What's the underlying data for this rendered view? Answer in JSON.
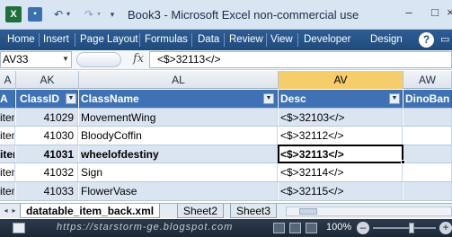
{
  "window": {
    "title": "Book3 - Microsoft Excel non-commercial use",
    "app_icon": "excel-icon",
    "qat_icons": [
      "save-icon",
      "undo-icon",
      "redo-icon",
      "customize-qat-icon"
    ],
    "controls": {
      "minimize": "–",
      "maximize": "□",
      "close": "×"
    }
  },
  "ribbon": {
    "tabs": [
      "Home",
      "Insert",
      "Page Layout",
      "Formulas",
      "Data",
      "Review",
      "View",
      "Developer",
      "Design"
    ],
    "help": "?",
    "more": "▭"
  },
  "formula_bar": {
    "name_box": "AV33",
    "fx": "fx",
    "content": "<$>32113</>"
  },
  "columns": [
    {
      "id": "A",
      "label": "A"
    },
    {
      "id": "AK",
      "label": "AK"
    },
    {
      "id": "AL",
      "label": "AL"
    },
    {
      "id": "AV",
      "label": "AV",
      "active": true
    },
    {
      "id": "AW",
      "label": "AW"
    }
  ],
  "table": {
    "headers": [
      "A",
      "ClassID",
      "ClassName",
      "Desc",
      "DinoBan"
    ],
    "rows": [
      {
        "a": "item",
        "id": "41029",
        "name": "MovementWing",
        "desc": "<$>32103</>"
      },
      {
        "a": "item",
        "id": "41030",
        "name": "BloodyCoffin",
        "desc": "<$>32112</>"
      },
      {
        "a": "item",
        "id": "41031",
        "name": "wheelofdestiny",
        "desc": "<$>32113</>",
        "selected": true
      },
      {
        "a": "item",
        "id": "41032",
        "name": "Sign",
        "desc": "<$>32114</>"
      },
      {
        "a": "item",
        "id": "41033",
        "name": "FlowerVase",
        "desc": "<$>32115</>"
      }
    ]
  },
  "sheet_tabs": [
    "datatable_item_back.xml",
    "Sheet2",
    "Sheet3"
  ],
  "active_sheet": "datatable_item_back.xml",
  "status": {
    "watermark": "https://starstorm-ge.blogspot.com",
    "zoom": "100%",
    "zoom_minus": "–",
    "zoom_plus": "+"
  }
}
